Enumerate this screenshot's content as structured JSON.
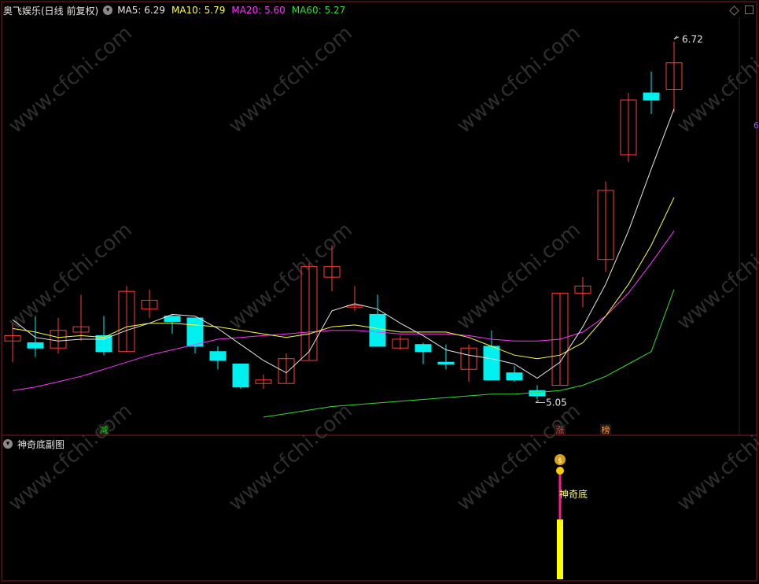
{
  "header": {
    "title": "奥飞娱乐(日线 前复权)",
    "ma": [
      {
        "label": "MA5: 6.29",
        "color": "#e8e8e8"
      },
      {
        "label": "MA10: 5.79",
        "color": "#ffff33"
      },
      {
        "label": "MA20: 5.60",
        "color": "#ff33ff"
      },
      {
        "label": "MA60: 5.27",
        "color": "#33dd33"
      }
    ]
  },
  "sub_panel": {
    "title": "神奇底副图",
    "signal_label": "神奇底",
    "signal_icon": "money-bag-icon"
  },
  "annotations": {
    "high": "6.72",
    "low": "5.05",
    "right_edge_mark": "6"
  },
  "markers": [
    {
      "text": "减",
      "color": "#22cc22"
    },
    {
      "text": "涨",
      "color": "#ff3333"
    },
    {
      "text": "榜",
      "color": "#ff9933"
    }
  ],
  "watermark": "www.cfchi.com",
  "colors": {
    "up": "#ff3b3b",
    "down": "#00f0f0",
    "background": "#000000",
    "ma5": "#e8e8e8",
    "ma10": "#ffff33",
    "ma20": "#ff33ff",
    "ma60": "#33dd33"
  },
  "chart_data": {
    "type": "candlestick",
    "candles": [
      {
        "open": 4.98,
        "close": 5.01,
        "high": 5.08,
        "low": 4.86
      },
      {
        "open": 4.97,
        "close": 4.94,
        "high": 5.12,
        "low": 4.89
      },
      {
        "open": 4.94,
        "close": 5.04,
        "high": 5.11,
        "low": 4.91
      },
      {
        "open": 5.03,
        "close": 5.06,
        "high": 5.24,
        "low": 4.98
      },
      {
        "open": 5.01,
        "close": 4.92,
        "high": 5.12,
        "low": 4.9
      },
      {
        "open": 4.92,
        "close": 5.26,
        "high": 5.29,
        "low": 4.92
      },
      {
        "open": 5.16,
        "close": 5.21,
        "high": 5.27,
        "low": 5.11
      },
      {
        "open": 5.12,
        "close": 5.09,
        "high": 5.13,
        "low": 5.02
      },
      {
        "open": 5.11,
        "close": 4.95,
        "high": 5.11,
        "low": 4.91
      },
      {
        "open": 4.92,
        "close": 4.87,
        "high": 4.95,
        "low": 4.82
      },
      {
        "open": 4.85,
        "close": 4.72,
        "high": 4.85,
        "low": 4.71
      },
      {
        "open": 4.74,
        "close": 4.76,
        "high": 4.79,
        "low": 4.71
      },
      {
        "open": 4.74,
        "close": 4.88,
        "high": 4.91,
        "low": 4.74
      },
      {
        "open": 4.87,
        "close": 5.4,
        "high": 5.42,
        "low": 4.87
      },
      {
        "open": 5.34,
        "close": 5.4,
        "high": 5.52,
        "low": 5.26
      },
      {
        "open": 5.18,
        "close": 5.18,
        "high": 5.29,
        "low": 5.15
      },
      {
        "open": 5.13,
        "close": 4.95,
        "high": 5.24,
        "low": 4.95
      },
      {
        "open": 4.94,
        "close": 4.99,
        "high": 5.01,
        "low": 4.93
      },
      {
        "open": 4.96,
        "close": 4.92,
        "high": 4.97,
        "low": 4.85
      },
      {
        "open": 4.86,
        "close": 4.85,
        "high": 4.96,
        "low": 4.82
      },
      {
        "open": 4.82,
        "close": 4.94,
        "high": 4.96,
        "low": 4.75
      },
      {
        "open": 4.95,
        "close": 4.76,
        "high": 5.04,
        "low": 4.76
      },
      {
        "open": 4.8,
        "close": 4.76,
        "high": 4.84,
        "low": 4.75
      },
      {
        "open": 4.7,
        "close": 4.67,
        "high": 4.73,
        "low": 4.65
      },
      {
        "open": 4.73,
        "close": 5.25,
        "high": 5.25,
        "low": 4.73
      },
      {
        "open": 5.25,
        "close": 5.29,
        "high": 5.34,
        "low": 5.17
      },
      {
        "open": 5.44,
        "close": 5.83,
        "high": 5.88,
        "low": 5.37
      },
      {
        "open": 6.03,
        "close": 6.34,
        "high": 6.38,
        "low": 5.99
      },
      {
        "open": 6.38,
        "close": 6.34,
        "high": 6.5,
        "low": 6.26
      },
      {
        "open": 6.4,
        "close": 6.55,
        "high": 6.67,
        "low": 6.27
      }
    ],
    "ma5": [
      5.1,
      5.0,
      4.98,
      4.99,
      4.99,
      5.04,
      5.08,
      5.13,
      5.12,
      5.05,
      4.96,
      4.87,
      4.8,
      4.92,
      5.15,
      5.19,
      5.16,
      5.08,
      5.01,
      4.93,
      4.9,
      4.88,
      4.85,
      4.77,
      4.86,
      5.06,
      5.3,
      5.6,
      5.95,
      6.29
    ],
    "ma10": [
      5.05,
      5.03,
      5.0,
      5.01,
      5.0,
      5.06,
      5.08,
      5.08,
      5.07,
      5.06,
      5.04,
      5.02,
      5.0,
      5.02,
      5.06,
      5.07,
      5.05,
      5.03,
      5.03,
      5.03,
      5.0,
      4.95,
      4.9,
      4.88,
      4.9,
      4.97,
      5.12,
      5.3,
      5.52,
      5.79
    ],
    "ma20": [
      4.7,
      4.72,
      4.75,
      4.78,
      4.82,
      4.86,
      4.9,
      4.93,
      4.96,
      4.99,
      5.0,
      5.01,
      5.02,
      5.03,
      5.04,
      5.04,
      5.03,
      5.02,
      5.02,
      5.02,
      5.01,
      4.99,
      4.98,
      4.98,
      4.99,
      5.03,
      5.12,
      5.25,
      5.42,
      5.6
    ],
    "ma60": [
      null,
      null,
      null,
      null,
      null,
      null,
      null,
      null,
      null,
      null,
      null,
      4.55,
      4.57,
      4.59,
      4.61,
      4.62,
      4.63,
      4.64,
      4.65,
      4.66,
      4.67,
      4.68,
      4.68,
      4.69,
      4.7,
      4.73,
      4.78,
      4.85,
      4.92,
      5.27
    ],
    "ylim": [
      4.55,
      6.78
    ],
    "signal_index": 24
  }
}
